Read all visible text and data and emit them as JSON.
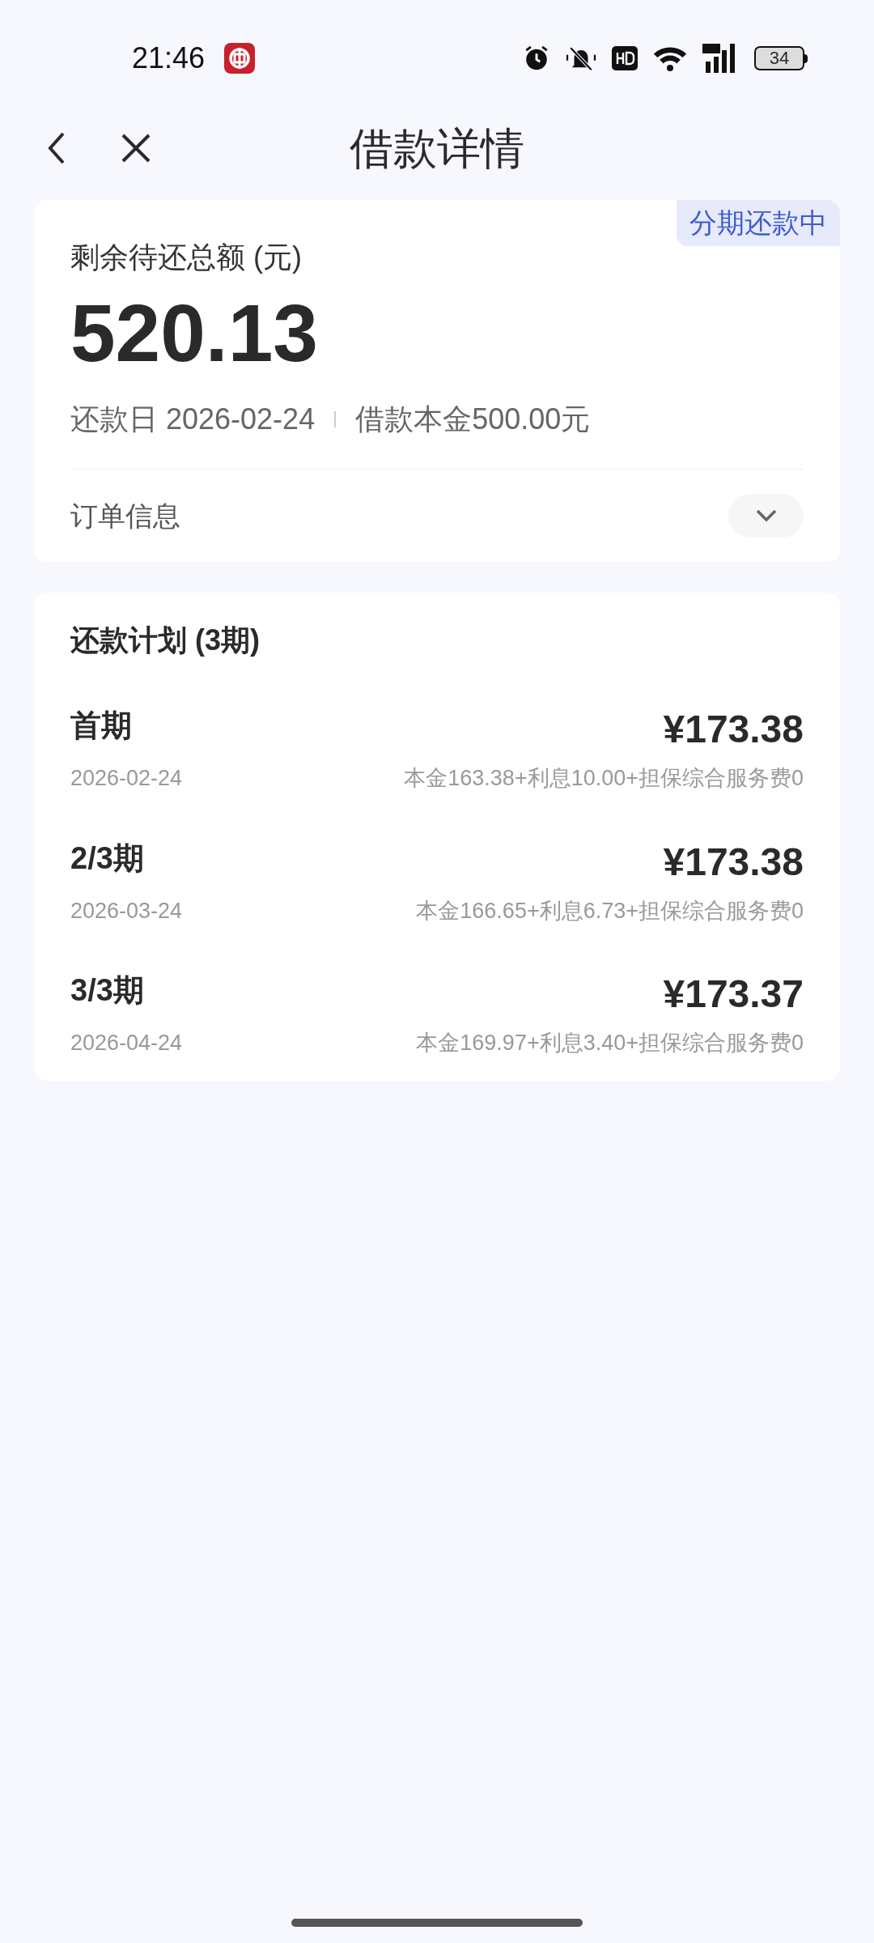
{
  "status_bar": {
    "time": "21:46",
    "battery": "34"
  },
  "header": {
    "title": "借款详情"
  },
  "summary": {
    "badge": "分期还款中",
    "label": "剩余待还总额 (元)",
    "amount": "520.13",
    "due_date": "还款日 2026-02-24",
    "principal": "借款本金500.00元",
    "order_info": "订单信息",
    "expanded": false
  },
  "plan": {
    "title": "还款计划 (3期)",
    "rows": [
      {
        "period": "首期",
        "amount": "¥173.38",
        "date": "2026-02-24",
        "breakdown": "本金163.38+利息10.00+担保综合服务费0"
      },
      {
        "period": "2/3期",
        "amount": "¥173.38",
        "date": "2026-03-24",
        "breakdown": "本金166.65+利息6.73+担保综合服务费0"
      },
      {
        "period": "3/3期",
        "amount": "¥173.37",
        "date": "2026-04-24",
        "breakdown": "本金169.97+利息3.40+担保综合服务费0"
      }
    ]
  }
}
